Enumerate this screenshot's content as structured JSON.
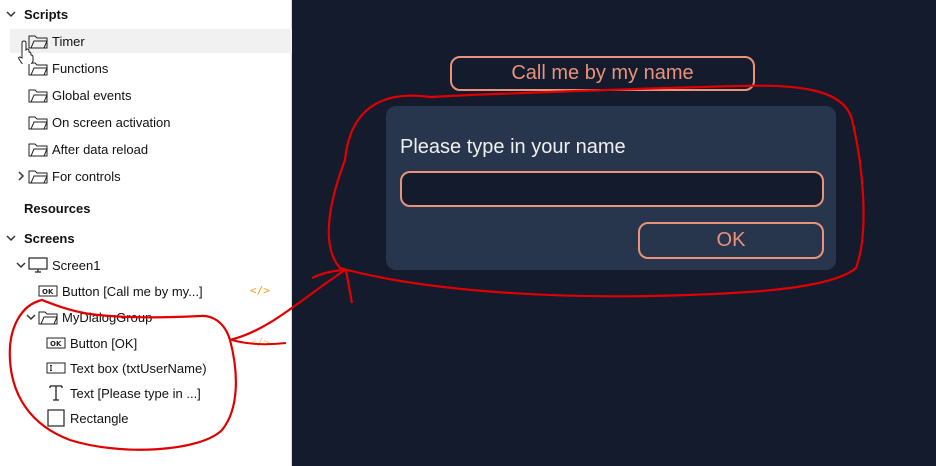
{
  "tree": {
    "scripts_label": "Scripts",
    "scripts_items": [
      {
        "label": "Timer"
      },
      {
        "label": "Functions"
      },
      {
        "label": "Global events"
      },
      {
        "label": "On screen activation"
      },
      {
        "label": "After data reload"
      },
      {
        "label": "For controls"
      }
    ],
    "resources_label": "Resources",
    "screens_label": "Screens",
    "screen1_label": "Screen1",
    "button_call_label": "Button [Call me by my...]",
    "group_label": "MyDialogGroup",
    "button_ok_label": "Button [OK]",
    "textbox_label": "Text box  (txtUserName)",
    "text_label": "Text [Please type in ...]",
    "rectangle_label": "Rectangle",
    "code_glyph": "</>"
  },
  "canvas": {
    "call_button_label": "Call me by my name",
    "dialog_label": "Please type in your name",
    "input_value": "",
    "ok_label": "OK"
  },
  "colors": {
    "canvas_bg": "#141b2d",
    "dialog_bg": "#27364d",
    "accent": "#e8937a",
    "annotation": "#e00000"
  }
}
